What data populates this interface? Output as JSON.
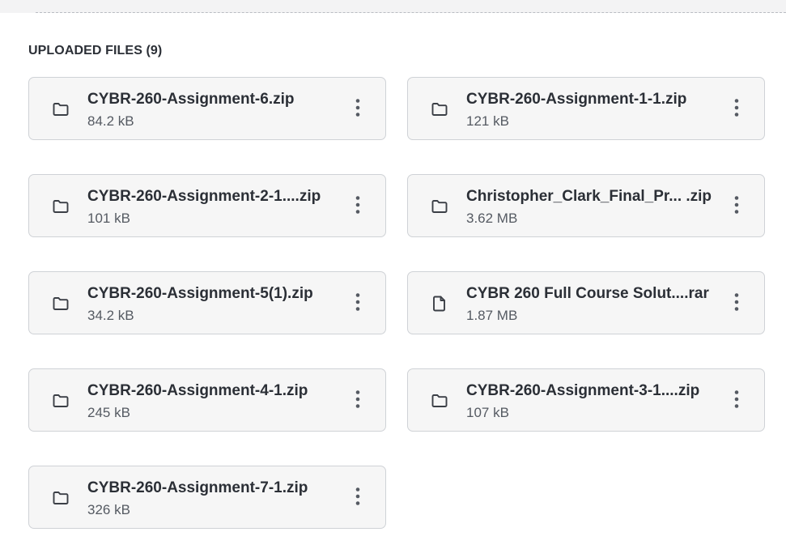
{
  "section": {
    "title": "UPLOADED FILES (9)"
  },
  "files": [
    {
      "name": "CYBR-260-Assignment-6.zip",
      "size": "84.2 kB",
      "icon": "folder-icon"
    },
    {
      "name": "CYBR-260-Assignment-1-1.zip",
      "size": "121 kB",
      "icon": "folder-icon"
    },
    {
      "name": "CYBR-260-Assignment-2-1....zip",
      "size": "101 kB",
      "icon": "folder-icon"
    },
    {
      "name": "Christopher_Clark_Final_Pr... .zip",
      "size": "3.62 MB",
      "icon": "folder-icon"
    },
    {
      "name": "CYBR-260-Assignment-5(1).zip",
      "size": "34.2 kB",
      "icon": "folder-icon"
    },
    {
      "name": "CYBR 260 Full Course Solut....rar",
      "size": "1.87 MB",
      "icon": "file-icon"
    },
    {
      "name": "CYBR-260-Assignment-4-1.zip",
      "size": "245 kB",
      "icon": "folder-icon"
    },
    {
      "name": "CYBR-260-Assignment-3-1....zip",
      "size": "107 kB",
      "icon": "folder-icon"
    },
    {
      "name": "CYBR-260-Assignment-7-1.zip",
      "size": "326 kB",
      "icon": "folder-icon"
    }
  ],
  "icons": {
    "menu": "more-vertical-icon"
  },
  "colors": {
    "card_background": "#f6f6f6",
    "card_border": "#cfd2d6",
    "text_primary": "#2b2f36",
    "text_secondary": "#555a62",
    "icon": "#3b3f46"
  }
}
